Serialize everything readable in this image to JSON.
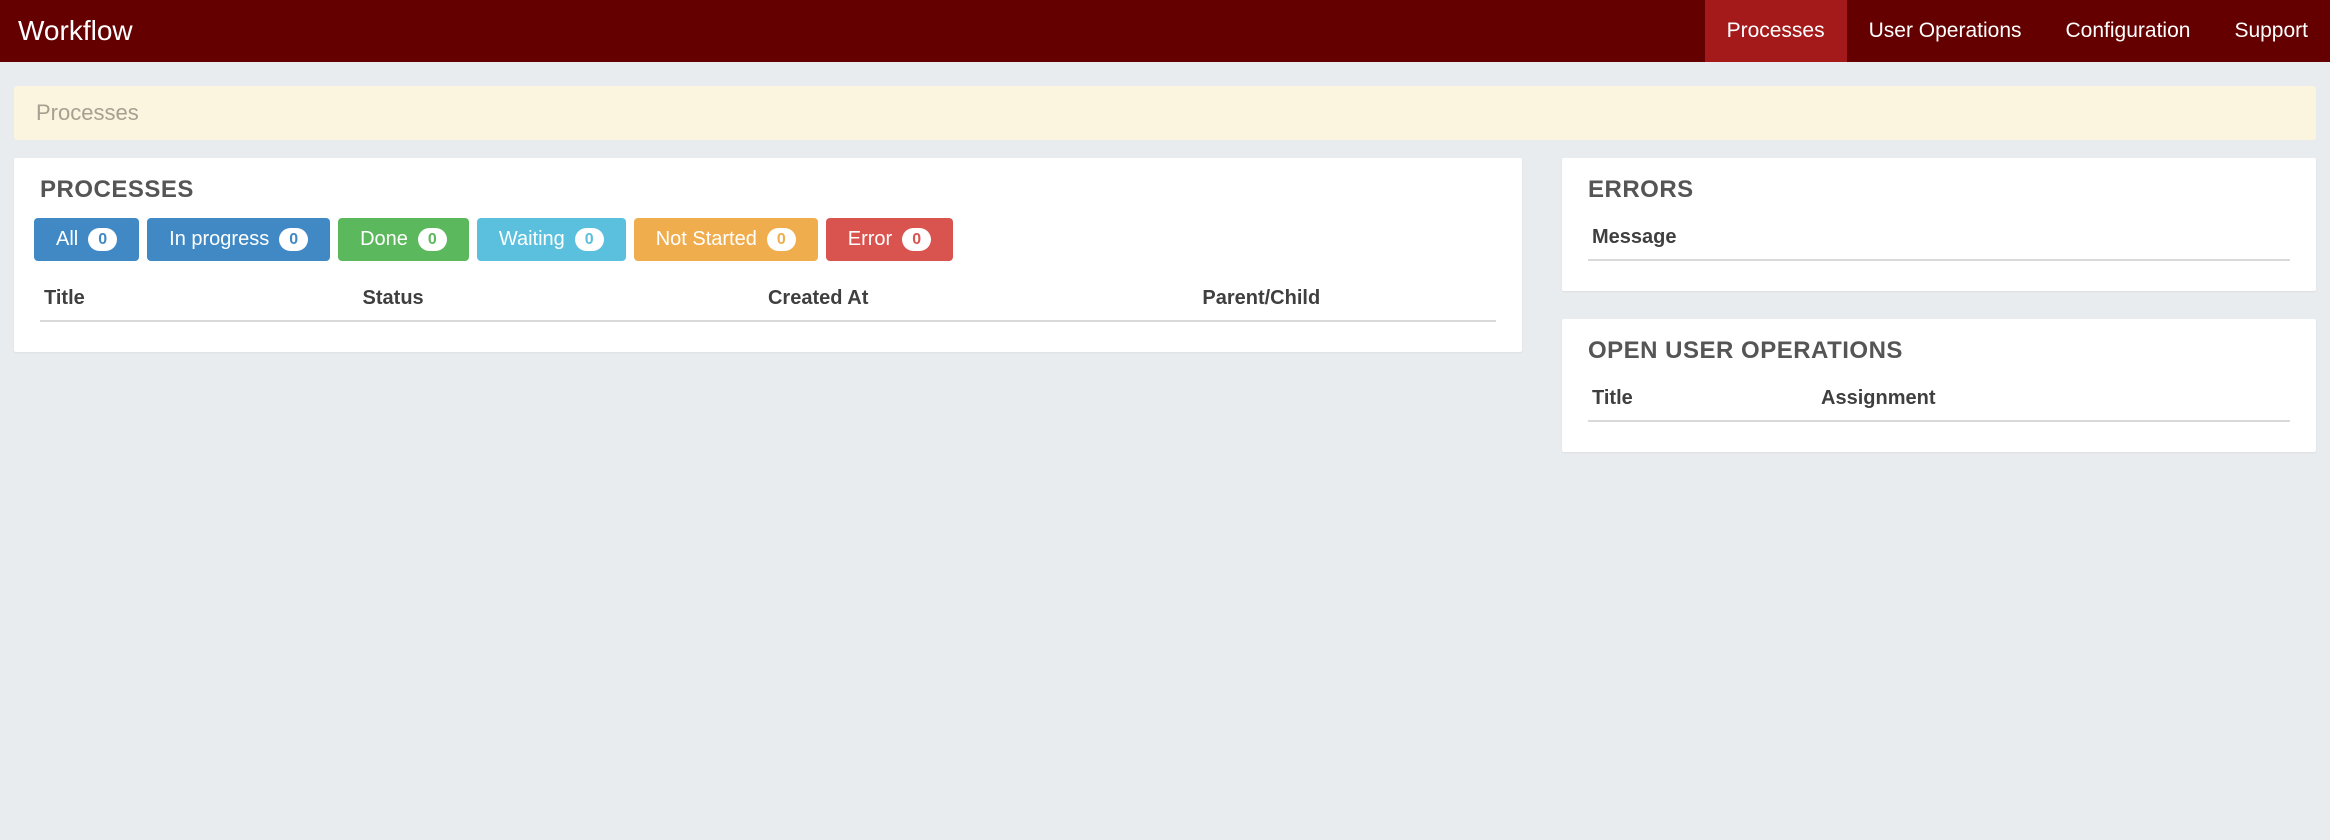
{
  "navbar": {
    "brand": "Workflow",
    "items": [
      {
        "label": "Processes",
        "active": true
      },
      {
        "label": "User Operations",
        "active": false
      },
      {
        "label": "Configuration",
        "active": false
      },
      {
        "label": "Support",
        "active": false
      }
    ]
  },
  "breadcrumb": "Processes",
  "processes_panel": {
    "title": "PROCESSES",
    "filters": [
      {
        "label": "All",
        "count": 0,
        "color": "blue"
      },
      {
        "label": "In progress",
        "count": 0,
        "color": "blue"
      },
      {
        "label": "Done",
        "count": 0,
        "color": "green"
      },
      {
        "label": "Waiting",
        "count": 0,
        "color": "cyan"
      },
      {
        "label": "Not Started",
        "count": 0,
        "color": "orange"
      },
      {
        "label": "Error",
        "count": 0,
        "color": "red"
      }
    ],
    "columns": {
      "title": "Title",
      "status": "Status",
      "created_at": "Created At",
      "parent_child": "Parent/Child"
    }
  },
  "errors_panel": {
    "title": "ERRORS",
    "columns": {
      "message": "Message"
    }
  },
  "user_ops_panel": {
    "title": "OPEN USER OPERATIONS",
    "columns": {
      "title": "Title",
      "assignment": "Assignment"
    }
  }
}
